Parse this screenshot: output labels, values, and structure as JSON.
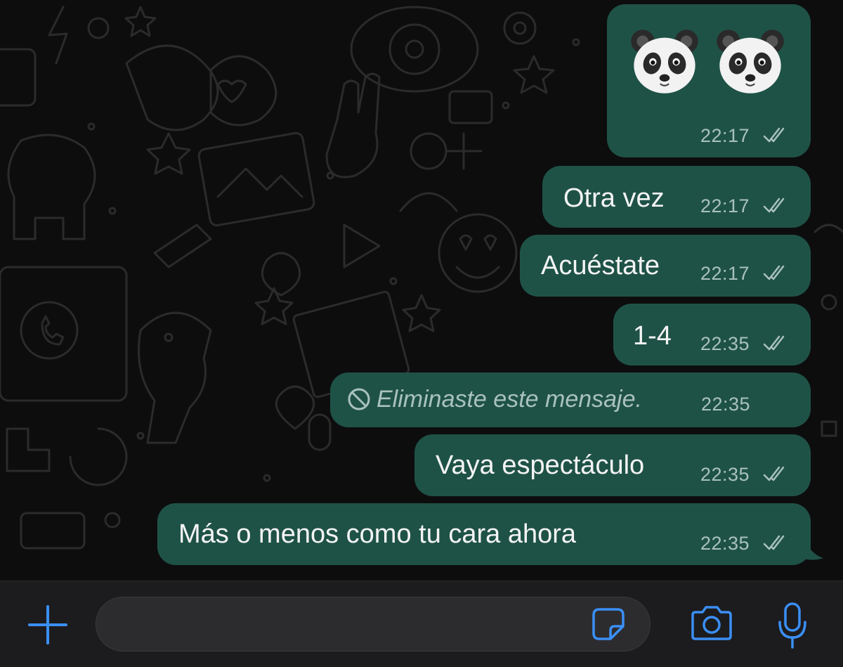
{
  "colors": {
    "outgoing_bubble": "#1f5247",
    "background": "#0d0d0d",
    "accent_blue": "#3b8ff6",
    "timestamp": "#a9c2bc",
    "input_bar": "#1c1c1e"
  },
  "messages": [
    {
      "type": "emoji",
      "content": "🐼🐼",
      "time": "22:17",
      "status": "read-double-check-icon"
    },
    {
      "type": "text",
      "text": "Otra vez",
      "time": "22:17",
      "status": "read-double-check-icon"
    },
    {
      "type": "text",
      "text": "Acuéstate",
      "time": "22:17",
      "status": "read-double-check-icon"
    },
    {
      "type": "text",
      "text": "1-4",
      "time": "22:35",
      "status": "read-double-check-icon"
    },
    {
      "type": "deleted",
      "text": "Eliminaste este mensaje.",
      "time": "22:35",
      "icon": "blocked-icon"
    },
    {
      "type": "text",
      "text": "Vaya espectáculo",
      "time": "22:35",
      "status": "read-double-check-icon"
    },
    {
      "type": "text",
      "text": "Más o menos como tu cara ahora",
      "time": "22:35",
      "status": "read-double-check-icon"
    }
  ],
  "input_bar": {
    "message_placeholder": "",
    "icons": [
      "plus-icon",
      "sticker-icon",
      "camera-icon",
      "microphone-icon"
    ]
  }
}
